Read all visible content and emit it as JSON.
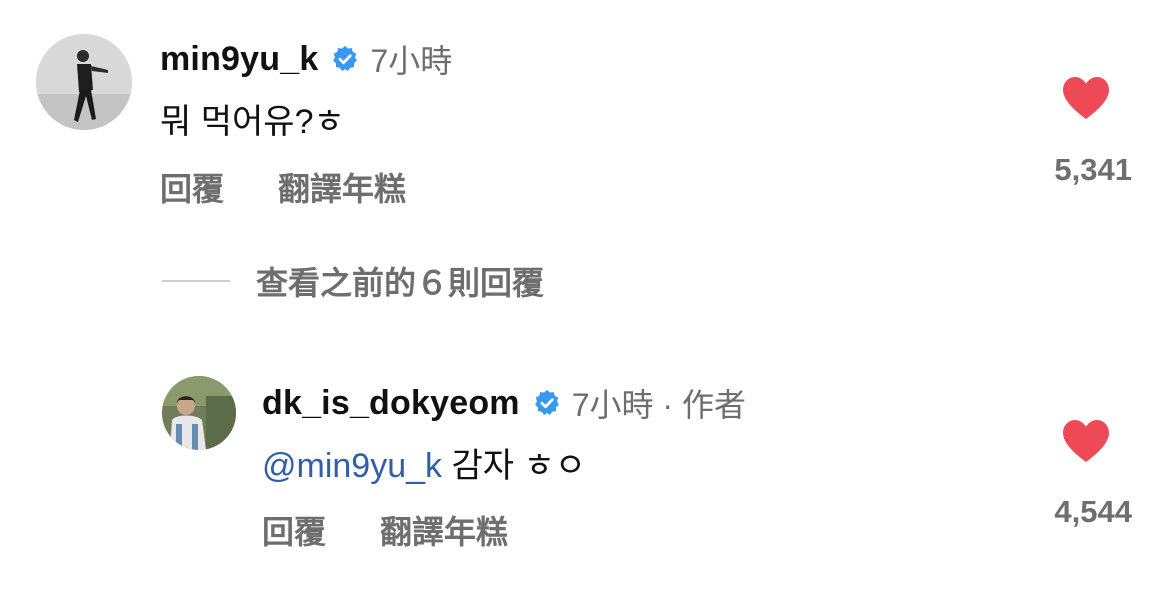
{
  "colors": {
    "text": "#111111",
    "muted": "#6e6e6e",
    "heart": "#ed4956",
    "verified": "#3897f0",
    "mention": "#2f5fa8"
  },
  "comment": {
    "username": "min9yu_k",
    "verified_icon": "verified-badge-icon",
    "time": "7小時",
    "text": "뭐 먹어유?ㅎ",
    "reply_label": "回覆",
    "translate_label": "翻譯年糕",
    "heart_icon": "heart-filled-icon",
    "likes": "5,341"
  },
  "view_previous": {
    "label": "查看之前的６則回覆"
  },
  "reply": {
    "username": "dk_is_dokyeom",
    "verified_icon": "verified-badge-icon",
    "time": "7小時 · 作者",
    "mention": "@min9yu_k",
    "text": " 감자 ㅎㅇ",
    "reply_label": "回覆",
    "translate_label": "翻譯年糕",
    "heart_icon": "heart-filled-icon",
    "likes": "4,544"
  }
}
